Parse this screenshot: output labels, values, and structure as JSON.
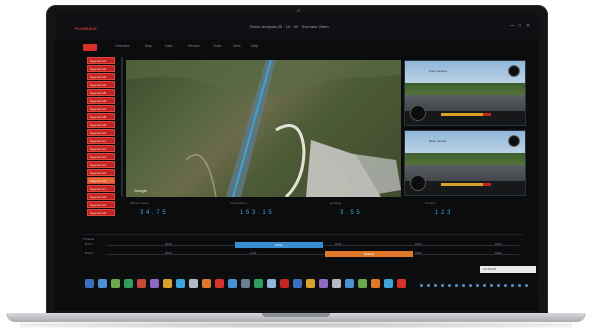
{
  "window": {
    "app_name": "PLAYBACK",
    "title": "Route Analysis 05 · 14 · 02 · Scenario Video",
    "controls": [
      "—",
      "□",
      "✕"
    ]
  },
  "menu": {
    "active": "●",
    "items": [
      "Overview",
      "Map",
      "Data",
      "Review",
      "Tools",
      "View",
      "Help"
    ]
  },
  "sidebar": {
    "items": [
      "Segment 01",
      "Segment 02",
      "Segment 03",
      "Segment 04",
      "Segment 05",
      "Segment 06",
      "Segment 07",
      "Segment 08",
      "Segment 09",
      "Segment 10",
      "Segment 11",
      "Segment 12",
      "Segment 13",
      "Segment 14",
      "Segment 15",
      "Segment 16",
      "Segment 17",
      "Segment 18",
      "Segment 19",
      "Segment 20"
    ],
    "selected_index": 15
  },
  "map": {
    "caption": "Google"
  },
  "cameras": [
    {
      "label": "Front camera"
    },
    {
      "label": "Rear camera"
    }
  ],
  "metrics": [
    {
      "label": "Vehicle speed",
      "value": "3 4 . 7 5"
    },
    {
      "label": "Acceleration",
      "value": "1 5 3 . 1 5"
    },
    {
      "label": "Heading",
      "value": "3 . 5 5"
    },
    {
      "label": "Position",
      "value": "1 2 3"
    }
  ],
  "timeline": {
    "title": "Timeline",
    "rows": [
      {
        "label": "Event",
        "segment_label": "Active",
        "ticks": [
          "00:00",
          "01:00",
          "02:00",
          "03:00",
          "04:00"
        ]
      },
      {
        "label": "Driver",
        "segment_label": "Braking",
        "ticks": [
          "00:00",
          "01:00",
          "02:00",
          "03:00",
          "04:00"
        ]
      }
    ]
  },
  "tray": {
    "text": "12:45 PM"
  },
  "colors": {
    "accent_red": "#d6322b",
    "timeline_blue": "#3b8fd1",
    "timeline_orange": "#e0782a",
    "metric_blue": "#4aa3d9"
  }
}
